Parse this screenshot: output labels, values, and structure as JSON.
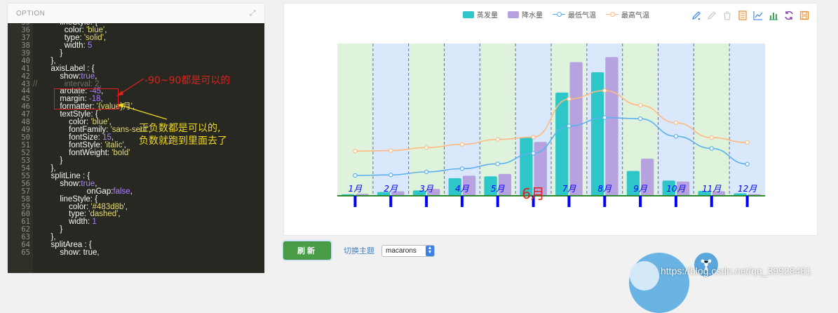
{
  "option_panel": {
    "title": "OPTION",
    "line_numbers": [
      "35",
      "36",
      "37",
      "38",
      "39",
      "40",
      "41",
      "42",
      "43",
      "44",
      "45",
      "46",
      "47",
      "48",
      "49",
      "50",
      "51",
      "52",
      "53",
      "54",
      "55",
      "56",
      "57",
      "58",
      "59",
      "60",
      "61",
      "62",
      "63",
      "64",
      "65"
    ],
    "code_lines": [
      [
        {
          "t": "            lineStyle: {",
          "c": "k"
        }
      ],
      [
        {
          "t": "              color: ",
          "c": "k"
        },
        {
          "t": "'blue'",
          "c": "s"
        },
        {
          "t": ",",
          "c": "k"
        }
      ],
      [
        {
          "t": "              type: ",
          "c": "k"
        },
        {
          "t": "'solid'",
          "c": "s"
        },
        {
          "t": ",",
          "c": "k"
        }
      ],
      [
        {
          "t": "              width: ",
          "c": "k"
        },
        {
          "t": "5",
          "c": "n"
        }
      ],
      [
        {
          "t": "            }",
          "c": "k"
        }
      ],
      [
        {
          "t": "        },",
          "c": "k"
        }
      ],
      [
        {
          "t": "        axisLabel : {",
          "c": "k"
        }
      ],
      [
        {
          "t": "            show:",
          "c": "k"
        },
        {
          "t": "true",
          "c": "b"
        },
        {
          "t": ",",
          "c": "k"
        }
      ],
      [
        {
          "t": "//            interval: 2,",
          "c": "c"
        }
      ],
      [
        {
          "t": "            arotate: ",
          "c": "k"
        },
        {
          "t": "-45",
          "c": "n"
        },
        {
          "t": ",",
          "c": "k"
        }
      ],
      [
        {
          "t": "            margin: ",
          "c": "k"
        },
        {
          "t": "-18",
          "c": "n"
        },
        {
          "t": ",",
          "c": "k"
        }
      ],
      [
        {
          "t": "            formatter: ",
          "c": "k"
        },
        {
          "t": "'{value}月'",
          "c": "s"
        },
        {
          "t": ",",
          "c": "k"
        }
      ],
      [
        {
          "t": "            textStyle: {",
          "c": "k"
        }
      ],
      [
        {
          "t": "                color: ",
          "c": "k"
        },
        {
          "t": "'blue'",
          "c": "s"
        },
        {
          "t": ",",
          "c": "k"
        }
      ],
      [
        {
          "t": "                fontFamily: ",
          "c": "k"
        },
        {
          "t": "'sans-serif'",
          "c": "s"
        },
        {
          "t": ",",
          "c": "k"
        }
      ],
      [
        {
          "t": "                fontSize: ",
          "c": "k"
        },
        {
          "t": "15",
          "c": "n"
        },
        {
          "t": ",",
          "c": "k"
        }
      ],
      [
        {
          "t": "                fontStyle: ",
          "c": "k"
        },
        {
          "t": "'italic'",
          "c": "s"
        },
        {
          "t": ",",
          "c": "k"
        }
      ],
      [
        {
          "t": "                fontWeight: ",
          "c": "k"
        },
        {
          "t": "'bold'",
          "c": "s"
        }
      ],
      [
        {
          "t": "            }",
          "c": "k"
        }
      ],
      [
        {
          "t": "        },",
          "c": "k"
        }
      ],
      [
        {
          "t": "        splitLine : {",
          "c": "k"
        }
      ],
      [
        {
          "t": "            show:",
          "c": "k"
        },
        {
          "t": "true",
          "c": "b"
        },
        {
          "t": ",",
          "c": "k"
        }
      ],
      [
        {
          "t": "                        onGap:",
          "c": "k"
        },
        {
          "t": "false",
          "c": "b"
        },
        {
          "t": ",",
          "c": "k"
        }
      ],
      [
        {
          "t": "            lineStyle: {",
          "c": "k"
        }
      ],
      [
        {
          "t": "                color: ",
          "c": "k"
        },
        {
          "t": "'#483d8b'",
          "c": "s"
        },
        {
          "t": ",",
          "c": "k"
        }
      ],
      [
        {
          "t": "                type: ",
          "c": "k"
        },
        {
          "t": "'dashed'",
          "c": "s"
        },
        {
          "t": ",",
          "c": "k"
        }
      ],
      [
        {
          "t": "                width: ",
          "c": "k"
        },
        {
          "t": "1",
          "c": "n"
        }
      ],
      [
        {
          "t": "            }",
          "c": "k"
        }
      ],
      [
        {
          "t": "        },",
          "c": "k"
        }
      ],
      [
        {
          "t": "        splitArea : {",
          "c": "k"
        }
      ],
      [
        {
          "t": "            show: true,",
          "c": "k"
        }
      ]
    ]
  },
  "annotations": {
    "rotate_note": "-90~90都是可以的",
    "margin_note_1": "正负数都是可以的,",
    "margin_note_2": "负数就跑到里面去了"
  },
  "legend": [
    {
      "label": "蒸发量",
      "kind": "bar",
      "color": "#2ec7c9"
    },
    {
      "label": "降水量",
      "kind": "bar",
      "color": "#b6a2de"
    },
    {
      "label": "最低气温",
      "kind": "line",
      "color": "#5ab1ef"
    },
    {
      "label": "最高气温",
      "kind": "line",
      "color": "#ffb980"
    }
  ],
  "toolbox": [
    "mark-icon",
    "mark-undo-icon",
    "mark-clear-icon",
    "data-view-icon",
    "line-chart-icon",
    "bar-chart-icon",
    "restore-icon",
    "save-image-icon"
  ],
  "chart_data": {
    "type": "bar",
    "categories": [
      "1月",
      "2月",
      "3月",
      "4月",
      "5月",
      "6月",
      "7月",
      "8月",
      "9月",
      "10月",
      "11月",
      "12月"
    ],
    "series": [
      {
        "name": "蒸发量",
        "type": "bar",
        "values": [
          2.0,
          4.9,
          7.0,
          23.2,
          25.6,
          76.7,
          135.6,
          162.2,
          32.6,
          20.0,
          6.4,
          3.3
        ]
      },
      {
        "name": "降水量",
        "type": "bar",
        "values": [
          2.6,
          5.9,
          9.0,
          26.4,
          28.7,
          70.7,
          175.6,
          182.2,
          48.7,
          18.8,
          6.0,
          2.3
        ]
      },
      {
        "name": "最低气温",
        "type": "line",
        "values": [
          2.0,
          2.2,
          3.3,
          4.5,
          6.3,
          10.2,
          20.3,
          23.4,
          23.0,
          16.5,
          12.0,
          6.2
        ]
      },
      {
        "name": "最高气温",
        "type": "line",
        "values": [
          11.0,
          11.2,
          12.3,
          13.5,
          15.3,
          16.2,
          30.3,
          33.4,
          28.0,
          21.5,
          16.0,
          14.2
        ]
      }
    ],
    "highlight_label": "6月",
    "split_area_colors": [
      "#dff3dc",
      "#d9e8fb"
    ],
    "split_line_color": "#483d8b",
    "axis_label_color": "blue",
    "axis_tick_color": "blue"
  },
  "controls": {
    "refresh_label": "刷新",
    "theme_label": "切换主题",
    "theme_value": "macarons"
  },
  "watermark": "https://blog.csdn.net/qq_39928481"
}
